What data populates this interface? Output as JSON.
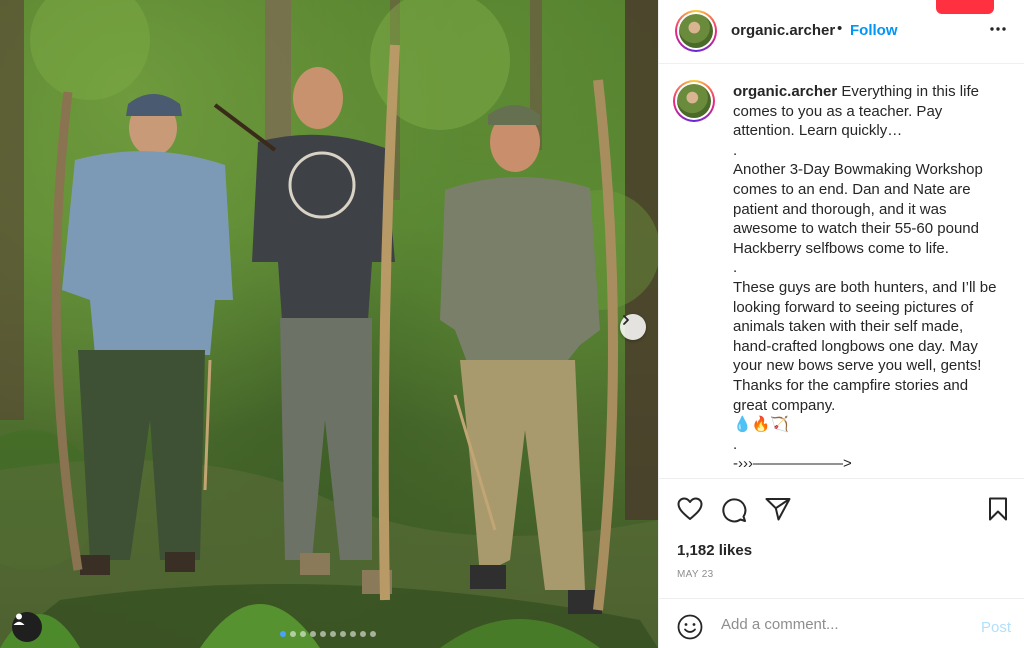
{
  "photo": {
    "description_icons": {
      "next": "chevron-right-icon",
      "tag": "person-icon"
    },
    "carousel": {
      "total": 10,
      "active": 0
    }
  },
  "header": {
    "username": "organic.archer",
    "separator": "•",
    "follow_label": "Follow",
    "more_icon": "more-horizontal-icon"
  },
  "caption": {
    "username": "organic.archer",
    "text": " Everything in this life comes to you as a teacher. Pay attention. Learn quickly…\n.\nAnother 3-Day Bowmaking Workshop comes to an end. Dan and Nate are patient and thorough, and it was awesome to watch their 55-60 pound Hackberry selfbows come to life.\n.\nThese guys are both hunters, and I’ll be looking forward to seeing pictures of animals taken with their self made, hand-crafted longbows one day. May your new bows serve you well, gents! Thanks for the campfire stories and great company.\n💧🔥🏹\n.\n-›››——————>"
  },
  "actions": {
    "like_icon": "heart-icon",
    "comment_icon": "comment-icon",
    "share_icon": "paper-plane-icon",
    "save_icon": "bookmark-icon"
  },
  "likes": "1,182 likes",
  "date": "MAY 23",
  "comment": {
    "placeholder": "Add a comment...",
    "post_label": "Post",
    "emoji_icon": "smiley-icon"
  },
  "colors": {
    "link": "#0095f6",
    "post_disabled": "#b2dffc",
    "muted": "#8e8e8e",
    "text": "#262626",
    "notification": "#ff3040"
  }
}
